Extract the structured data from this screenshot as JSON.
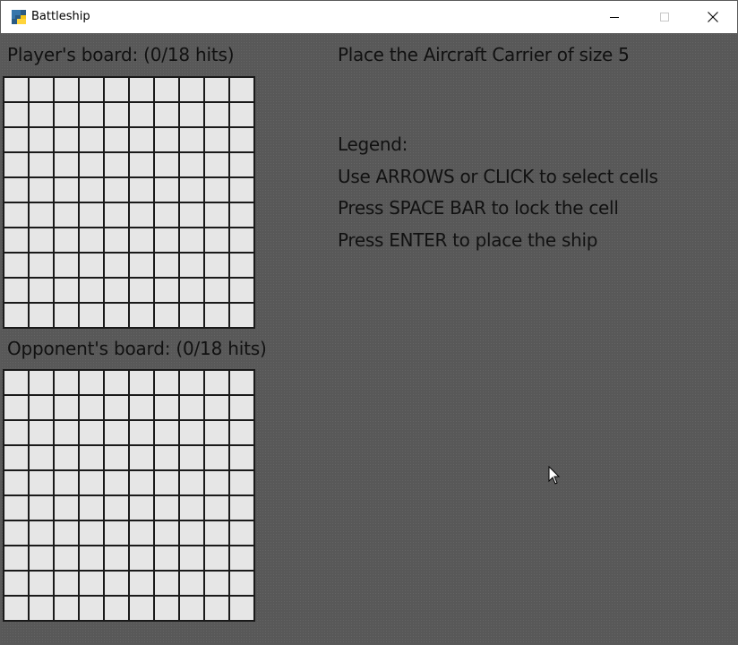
{
  "window": {
    "title": "Battleship",
    "icon": "python-app-icon",
    "controls": [
      "minimize-icon",
      "maximize-icon",
      "close-icon"
    ]
  },
  "player_board": {
    "label": "Player's board: (0/18 hits)",
    "rows": 10,
    "cols": 10
  },
  "opponent_board": {
    "label": "Opponent's board: (0/18 hits)",
    "rows": 10,
    "cols": 10
  },
  "instruction": "Place the Aircraft Carrier of size 5",
  "legend": {
    "title": "Legend:",
    "lines": [
      "Use ARROWS or CLICK to select cells",
      "Press SPACE BAR to lock the cell",
      "Press ENTER to place the ship"
    ]
  },
  "colors": {
    "background": "#585858",
    "cell": "#e6e6e6",
    "grid_line": "#1a1a1a"
  }
}
